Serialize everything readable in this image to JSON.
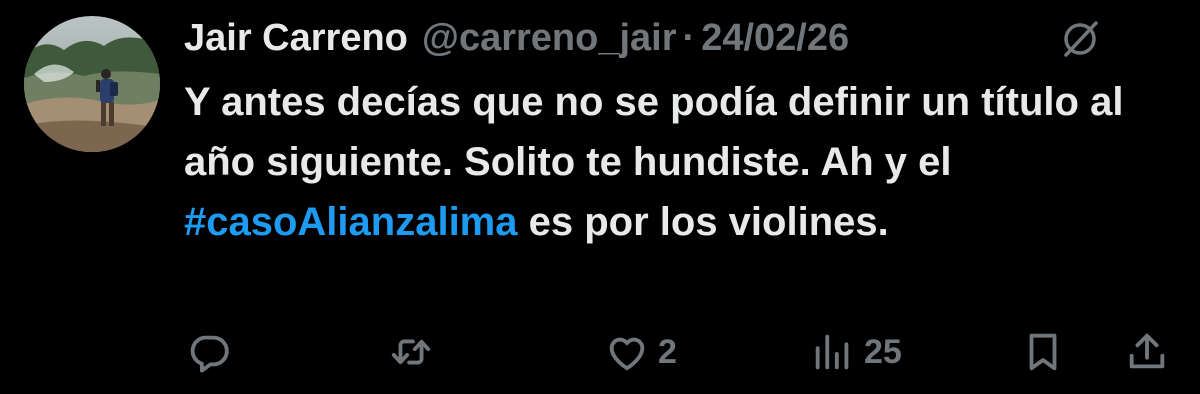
{
  "author": {
    "name": "Jair Carreno",
    "handle": "@carreno_jair",
    "separator": "·",
    "date": "24/02/26",
    "avatar": "avatar-photo-person-hiking"
  },
  "post": {
    "text_before": "Y antes decías que no se podía definir un título al año siguiente. Solito te hundiste. Ah y el ",
    "hashtag": "#casoAlianzalima",
    "text_after": " es por los violines."
  },
  "actions": {
    "reply": {
      "icon": "reply-icon",
      "count": ""
    },
    "repost": {
      "icon": "repost-icon",
      "count": ""
    },
    "like": {
      "icon": "heart-icon",
      "count": "2"
    },
    "views": {
      "icon": "views-icon",
      "count": "25"
    },
    "bookmark": {
      "icon": "bookmark-icon"
    },
    "share": {
      "icon": "share-icon"
    }
  },
  "colors": {
    "background": "#000000",
    "primary_text": "#e7e9ea",
    "secondary_text": "#71767b",
    "link": "#1d9bf0"
  }
}
